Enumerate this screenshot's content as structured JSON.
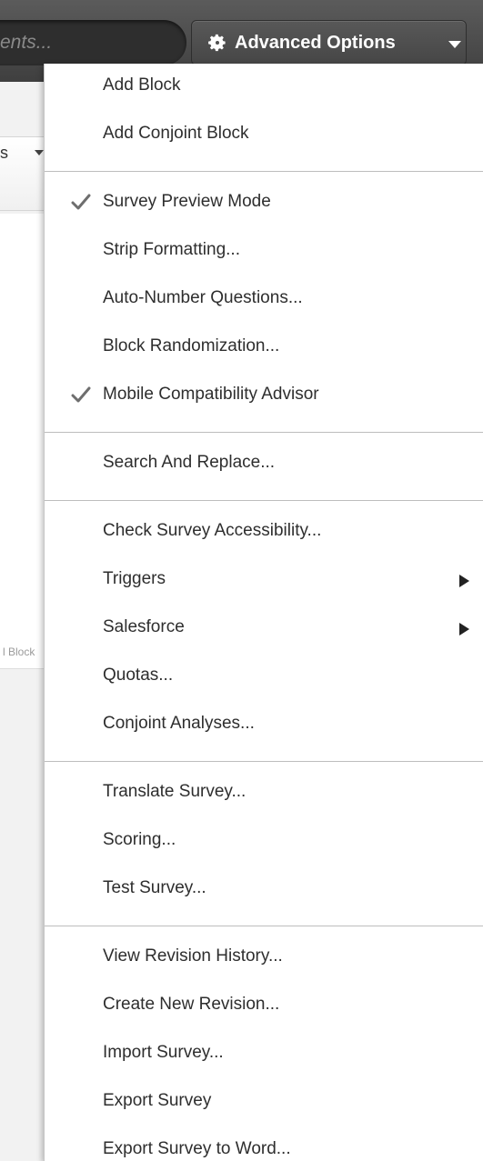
{
  "toolbar": {
    "search_placeholder": "ents...",
    "advanced_options_label": "Advanced Options",
    "advanced_options_icon": "gear-icon",
    "caret_icon": "caret-down-icon"
  },
  "background": {
    "tab_fragment": "s",
    "block_fragment": "l Block"
  },
  "menu": {
    "groups": [
      {
        "items": [
          {
            "label": "Add Block",
            "checked": false,
            "submenu": false
          },
          {
            "label": "Add Conjoint Block",
            "checked": false,
            "submenu": false
          }
        ]
      },
      {
        "items": [
          {
            "label": "Survey Preview Mode",
            "checked": true,
            "submenu": false
          },
          {
            "label": "Strip Formatting...",
            "checked": false,
            "submenu": false
          },
          {
            "label": "Auto-Number Questions...",
            "checked": false,
            "submenu": false
          },
          {
            "label": "Block Randomization...",
            "checked": false,
            "submenu": false
          },
          {
            "label": "Mobile Compatibility Advisor",
            "checked": true,
            "submenu": false
          }
        ]
      },
      {
        "items": [
          {
            "label": "Search And Replace...",
            "checked": false,
            "submenu": false
          }
        ]
      },
      {
        "items": [
          {
            "label": "Check Survey Accessibility...",
            "checked": false,
            "submenu": false
          },
          {
            "label": "Triggers",
            "checked": false,
            "submenu": true
          },
          {
            "label": "Salesforce",
            "checked": false,
            "submenu": true
          },
          {
            "label": "Quotas...",
            "checked": false,
            "submenu": false
          },
          {
            "label": "Conjoint Analyses...",
            "checked": false,
            "submenu": false
          }
        ]
      },
      {
        "items": [
          {
            "label": "Translate Survey...",
            "checked": false,
            "submenu": false
          },
          {
            "label": "Scoring...",
            "checked": false,
            "submenu": false
          },
          {
            "label": "Test Survey...",
            "checked": false,
            "submenu": false
          }
        ]
      },
      {
        "items": [
          {
            "label": "View Revision History...",
            "checked": false,
            "submenu": false
          },
          {
            "label": "Create New Revision...",
            "checked": false,
            "submenu": false
          },
          {
            "label": "Import Survey...",
            "checked": false,
            "submenu": false
          },
          {
            "label": "Export Survey",
            "checked": false,
            "submenu": false
          },
          {
            "label": "Export Survey to Word...",
            "checked": false,
            "submenu": false
          }
        ]
      }
    ]
  },
  "colors": {
    "toolbar_bg": "#4a4a4a",
    "menu_text": "#2e2e2e",
    "check_mark": "#6e6e6e",
    "divider": "#bdbdbd"
  }
}
